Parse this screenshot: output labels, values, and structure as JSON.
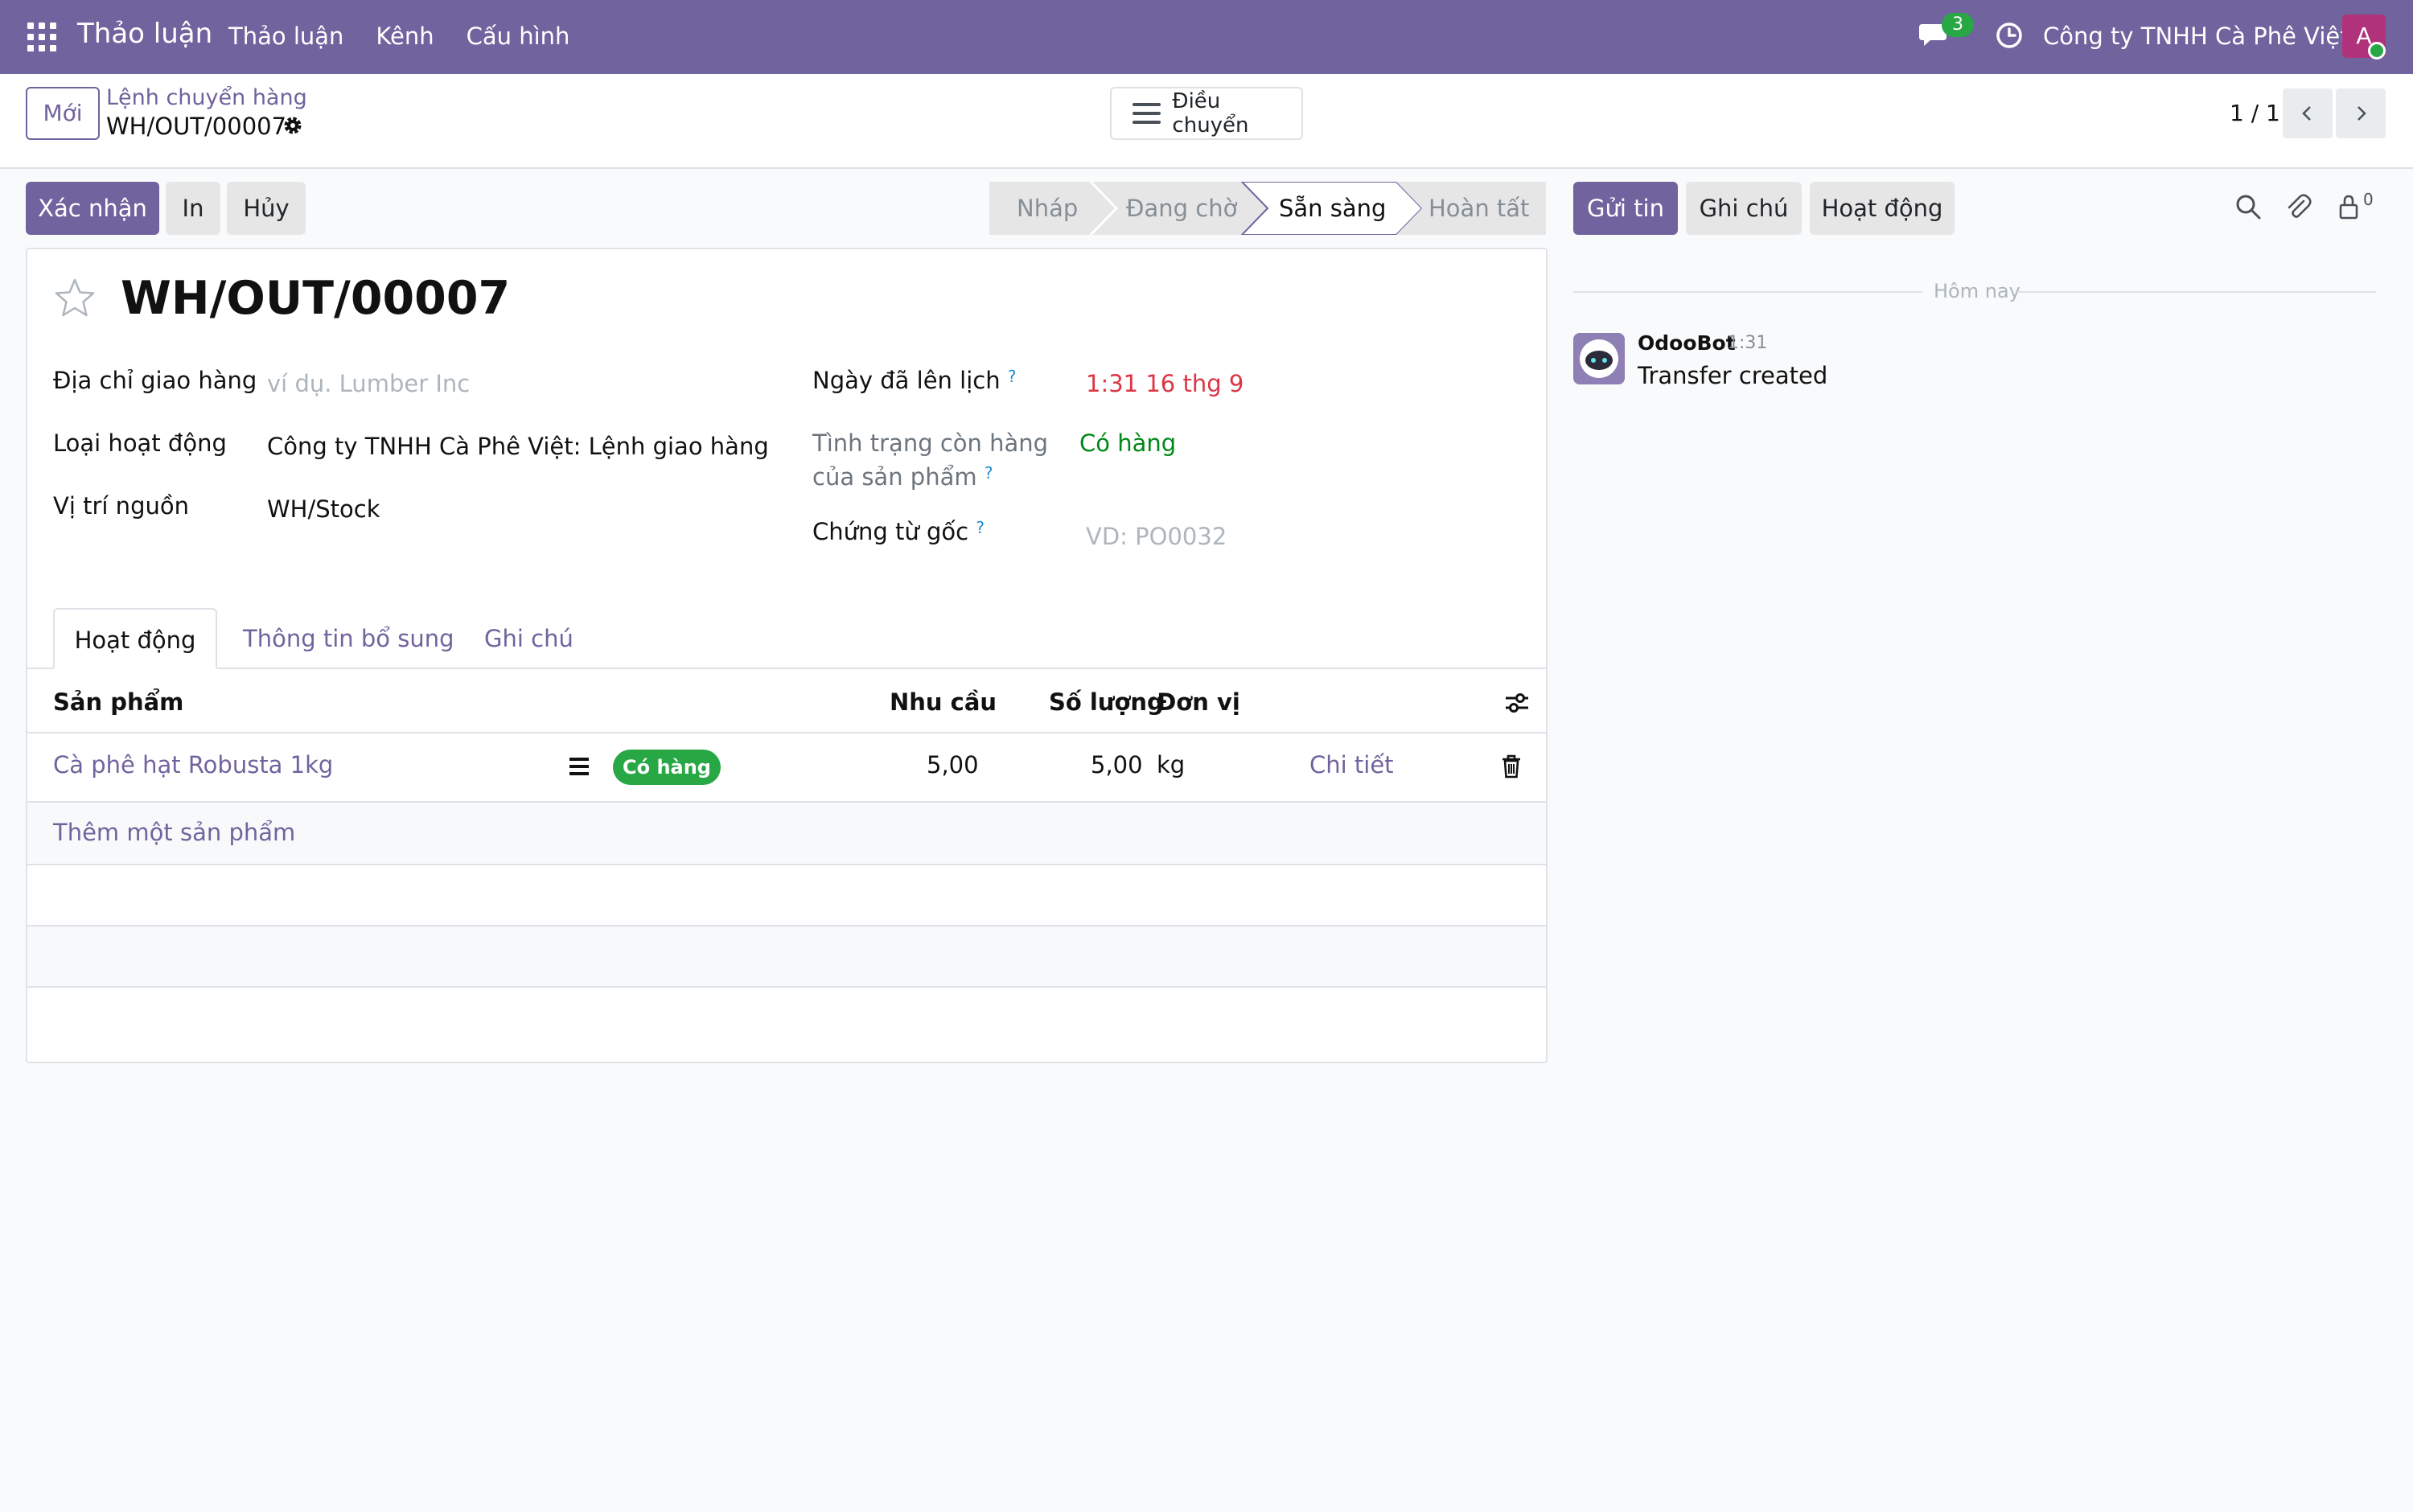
{
  "navbar": {
    "brand": "Thảo luận",
    "menu": [
      "Thảo luận",
      "Kênh",
      "Cấu hình"
    ],
    "message_count": "3",
    "company": "Công ty TNHH Cà Phê Việt",
    "avatar_letter": "A"
  },
  "control_panel": {
    "new_button": "Mới",
    "breadcrumb_parent": "Lệnh chuyển hàng",
    "breadcrumb_current": "WH/OUT/00007",
    "transfer_button": "Điều chuyển",
    "pager": "1 / 1"
  },
  "actions": {
    "confirm": "Xác nhận",
    "print": "In",
    "cancel": "Hủy"
  },
  "statusbar": {
    "stages": [
      "Nháp",
      "Đang chờ",
      "Sẵn sàng",
      "Hoàn tất"
    ],
    "active_stage": "Sẵn sàng"
  },
  "chatter_buttons": {
    "send": "Gửi tin",
    "note": "Ghi chú",
    "activity": "Hoạt động",
    "follower_count": "0"
  },
  "form": {
    "title": "WH/OUT/00007",
    "delivery_address_label": "Địa chỉ giao hàng",
    "delivery_address_placeholder": "ví dụ. Lumber Inc",
    "operation_type_label": "Loại hoạt động",
    "operation_type_value": "Công ty TNHH Cà Phê Việt: Lệnh giao hàng",
    "source_location_label": "Vị trí nguồn",
    "source_location_value": "WH/Stock",
    "scheduled_date_label": "Ngày đã lên lịch",
    "scheduled_date_value": "1:31 16 thg 9",
    "availability_label_1": "Tình trạng còn hàng",
    "availability_label_2": "của sản phẩm",
    "availability_value": "Có hàng",
    "source_doc_label": "Chứng từ gốc",
    "source_doc_placeholder": "VD: PO0032",
    "help_mark": "?"
  },
  "tabs": [
    "Hoạt động",
    "Thông tin bổ sung",
    "Ghi chú"
  ],
  "table": {
    "headers": {
      "product": "Sản phẩm",
      "demand": "Nhu cầu",
      "quantity": "Số lượng",
      "uom": "Đơn vị"
    },
    "rows": [
      {
        "product": "Cà phê hạt Robusta 1kg",
        "badge": "Có hàng",
        "demand": "5,00",
        "quantity": "5,00",
        "uom": "kg",
        "details": "Chi tiết"
      }
    ],
    "add_line": "Thêm một sản phẩm"
  },
  "chatter": {
    "date_divider": "Hôm nay",
    "messages": [
      {
        "author": "OdooBot",
        "time": "1:31",
        "body": "Transfer created"
      }
    ]
  },
  "colors": {
    "brand": "#71639e",
    "success": "#28a745",
    "danger": "#dc3545"
  }
}
